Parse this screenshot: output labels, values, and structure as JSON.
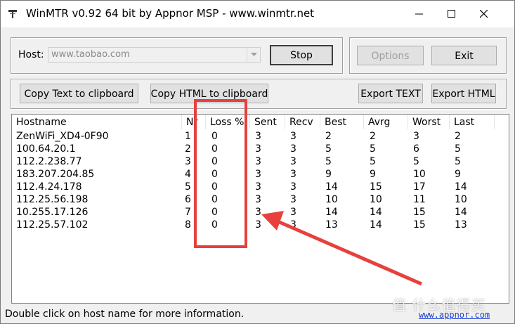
{
  "window": {
    "title": "WinMTR v0.92 64 bit by Appnor MSP - www.winmtr.net"
  },
  "host": {
    "label": "Host:",
    "value": "www.taobao.com"
  },
  "buttons": {
    "stop": "Stop",
    "options": "Options",
    "exit": "Exit",
    "copy_text": "Copy Text to clipboard",
    "copy_html": "Copy HTML to clipboard",
    "export_text": "Export TEXT",
    "export_html": "Export HTML"
  },
  "table": {
    "columns": [
      "Hostname",
      "Nr",
      "Loss %",
      "Sent",
      "Recv",
      "Best",
      "Avrg",
      "Worst",
      "Last"
    ],
    "rows": [
      [
        "ZenWiFi_XD4-0F90",
        "1",
        "0",
        "3",
        "3",
        "2",
        "2",
        "3",
        "2"
      ],
      [
        "100.64.20.1",
        "2",
        "0",
        "3",
        "3",
        "5",
        "5",
        "6",
        "5"
      ],
      [
        "112.2.238.77",
        "3",
        "0",
        "3",
        "3",
        "5",
        "5",
        "5",
        "5"
      ],
      [
        "183.207.204.85",
        "4",
        "0",
        "3",
        "3",
        "9",
        "9",
        "10",
        "9"
      ],
      [
        "112.4.24.178",
        "5",
        "0",
        "3",
        "3",
        "14",
        "15",
        "17",
        "14"
      ],
      [
        "112.25.56.198",
        "6",
        "0",
        "3",
        "3",
        "10",
        "10",
        "11",
        "10"
      ],
      [
        "10.255.17.126",
        "7",
        "0",
        "3",
        "3",
        "14",
        "14",
        "15",
        "14"
      ],
      [
        "112.25.57.102",
        "8",
        "0",
        "3",
        "3",
        "13",
        "14",
        "15",
        "13"
      ]
    ]
  },
  "status": {
    "text": "Double click on host name for more information.",
    "link": "www.appnor.com"
  },
  "watermark": "值 什么值得买",
  "colors": {
    "annotation": "#e8403c",
    "link": "#1a3fd1"
  }
}
